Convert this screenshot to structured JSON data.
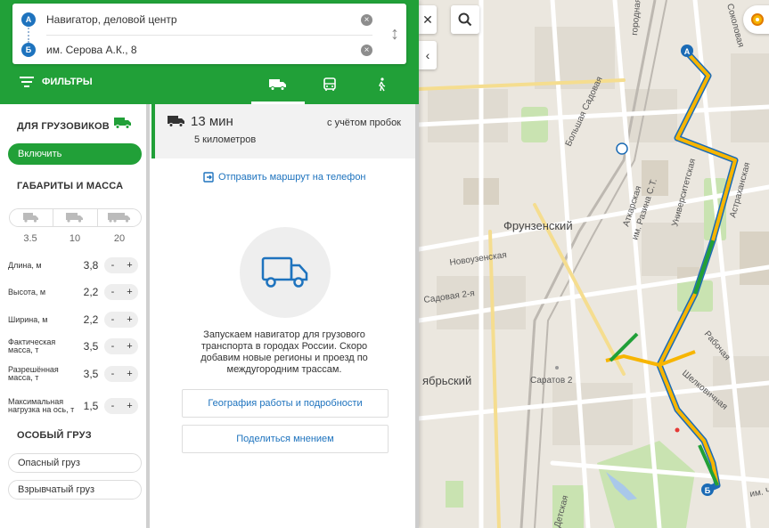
{
  "route": {
    "point_a_badge": "A",
    "point_a": "Навигатор, деловой центр",
    "point_b_badge": "Б",
    "point_b": "им. Серова А.К., 8"
  },
  "toolbar": {
    "filters_label": "ФИЛЬТРЫ",
    "modes": [
      {
        "name": "truck-icon",
        "active": true
      },
      {
        "name": "bus-icon",
        "active": false
      },
      {
        "name": "pedestrian-icon",
        "active": false
      }
    ]
  },
  "sidebar": {
    "trucks_heading": "ДЛЯ ГРУЗОВИКОВ",
    "enable_label": "Включить",
    "dims_heading": "ГАБАРИТЫ И МАССА",
    "truck_sizes": [
      "3.5",
      "10",
      "20"
    ],
    "params": [
      {
        "label": "Длина, м",
        "value": "3,8"
      },
      {
        "label": "Высота, м",
        "value": "2,2"
      },
      {
        "label": "Ширина, м",
        "value": "2,2"
      },
      {
        "label": "Фактическая масса, т",
        "value": "3,5"
      },
      {
        "label": "Разрешённая масса, т",
        "value": "3,5"
      },
      {
        "label": "Максимальная нагрузка на ось, т",
        "value": "1,5"
      }
    ],
    "stepper_minus": "-",
    "stepper_plus": "+",
    "special_heading": "ОСОБЫЙ ГРУЗ",
    "special_items": [
      "Опасный груз",
      "Взрывчатый груз"
    ]
  },
  "result": {
    "time": "13 мин",
    "distance": "5 километров",
    "traffic_note": "с учётом пробок",
    "send_link": "Отправить маршрут на телефон",
    "info": "Запускаем навигатор для грузового транспорта в городах России. Скоро добавим новые регионы и проезд по междугородним трассам.",
    "geo_button": "География работы и подробности",
    "feedback_button": "Поделиться мнением"
  },
  "map": {
    "labels": {
      "frunzensky": "Фрунзенский",
      "novouzenskaya": "Новоузенская",
      "sadovaya2": "Садовая 2-я",
      "saratov2": "Саратов 2",
      "shelkovichnaya": "Шелковичная",
      "rabochaya": "Рабочая",
      "atkarskaya": "Аткарская",
      "razina": "им. Разина С.Т.",
      "universitetskaya": "Университетская",
      "astrakhanskaya": "Астраханская",
      "sokolovaya": "Соколовая",
      "bolshaya_sadovaya": "Большая Садовая",
      "gorodnaya": "городная",
      "yabrsky": "ябрьский",
      "im_ch": "им. Ч",
      "detskaya": "Детская"
    },
    "pin_a": "A",
    "pin_b": "Б"
  },
  "colors": {
    "brand_green": "#21a038",
    "link_blue": "#1e73be",
    "route_yellow": "#f7b500"
  }
}
